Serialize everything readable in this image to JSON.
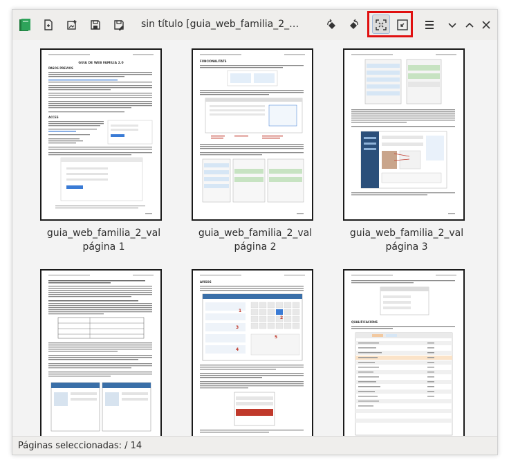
{
  "window": {
    "title": "sin título [guia_web_familia_2_val] – P…"
  },
  "toolbar": {
    "icons": [
      "app-logo-icon",
      "new-page-icon",
      "add-image-icon",
      "save-icon",
      "save-as-icon",
      "rotate-left-icon",
      "rotate-right-icon",
      "zoom-to-fit-icon",
      "zoom-to-selection-icon",
      "menu-icon",
      "minimize-icon",
      "maximize-icon",
      "close-icon"
    ]
  },
  "pages": [
    {
      "name": "guia_web_familia_2_val",
      "page_label": "página 1"
    },
    {
      "name": "guia_web_familia_2_val",
      "page_label": "página 2"
    },
    {
      "name": "guia_web_familia_2_val",
      "page_label": "página 3"
    },
    {
      "name": "",
      "page_label": ""
    },
    {
      "name": "",
      "page_label": ""
    },
    {
      "name": "",
      "page_label": ""
    }
  ],
  "thumb_text": {
    "p1_title": "GUIA DE WEB FAMILIA 2.0",
    "p1_h1": "PASOS PREVIOS",
    "p1_h2": "ACCES",
    "p2_h1": "FUNCIONALITATS",
    "p5_h1": "AVISOS",
    "p6_h1": "QUALIFICACIONS"
  },
  "status": {
    "text": "Páginas seleccionadas:  / 14"
  },
  "colors": {
    "highlight": "#e01010",
    "accent_red": "#c0392b",
    "ui_blue": "#3a7bd5"
  }
}
